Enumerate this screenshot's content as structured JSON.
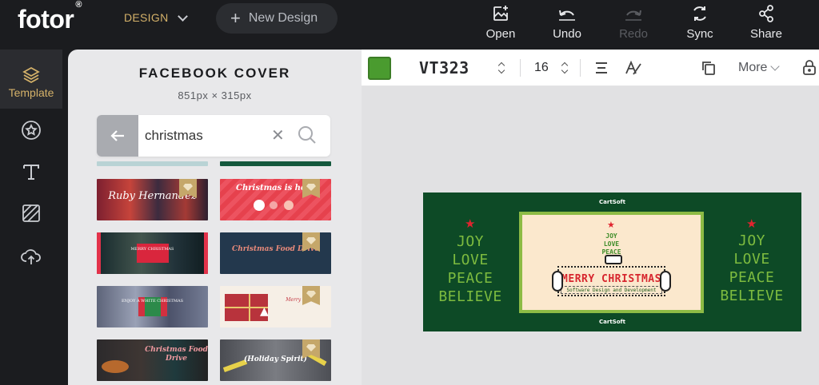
{
  "app": {
    "logo_text": "fotor",
    "logo_mark": "®"
  },
  "header": {
    "design_menu_label": "DESIGN",
    "new_design_label": "New Design",
    "tools": [
      {
        "label": "Open",
        "icon": "image-plus-icon",
        "enabled": true
      },
      {
        "label": "Undo",
        "icon": "undo-icon",
        "enabled": true
      },
      {
        "label": "Redo",
        "icon": "redo-icon",
        "enabled": false
      },
      {
        "label": "Sync",
        "icon": "sync-icon",
        "enabled": true
      },
      {
        "label": "Share",
        "icon": "share-icon",
        "enabled": true
      }
    ]
  },
  "rail": {
    "items": [
      {
        "label": "Template",
        "icon": "layers-icon",
        "active": true
      },
      {
        "icon": "star-circle-icon"
      },
      {
        "icon": "text-icon"
      },
      {
        "icon": "background-pattern-icon"
      },
      {
        "icon": "cloud-upload-icon"
      }
    ]
  },
  "panel": {
    "title": "FACEBOOK COVER",
    "size": "851px × 315px",
    "search": {
      "value": "christmas",
      "placeholder": ""
    },
    "templates": [
      {
        "text": "Ruby Hernandez",
        "premium": true
      },
      {
        "text": "Christmas is here",
        "premium": true
      },
      {
        "text": "MERRY CHRISTMAS",
        "premium": false
      },
      {
        "text": "Christmas Food Drive",
        "premium": true
      },
      {
        "text": "ENJOY A WHITE CHRISTMAS",
        "premium": false
      },
      {
        "text": "Merry xmas",
        "premium": true
      },
      {
        "text": "Christmas Food Drive",
        "premium": false
      },
      {
        "text": "(Holiday Spirit)",
        "premium": true
      }
    ]
  },
  "toolbar": {
    "color": "#4a9b2f",
    "font_name": "VT323",
    "font_size": "16",
    "more_label": "More"
  },
  "canvas": {
    "brand_top": "CartSoft",
    "brand_bottom": "CartSoft",
    "left_words": [
      "JOY",
      "LOVE",
      "PEACE",
      "BELIEVE"
    ],
    "right_words": [
      "JOY",
      "LOVE",
      "PEACE",
      "BELIEVE"
    ],
    "tree_words": [
      "JOY",
      "LOVE",
      "PEACE"
    ],
    "headline": "MERRY CHRISTMAS",
    "subline": "Software Design and Development",
    "colors": {
      "background": "#0d4a26",
      "accent_green": "#7dbb3f",
      "card": "#fbe8cd",
      "red": "#d7262e"
    }
  }
}
